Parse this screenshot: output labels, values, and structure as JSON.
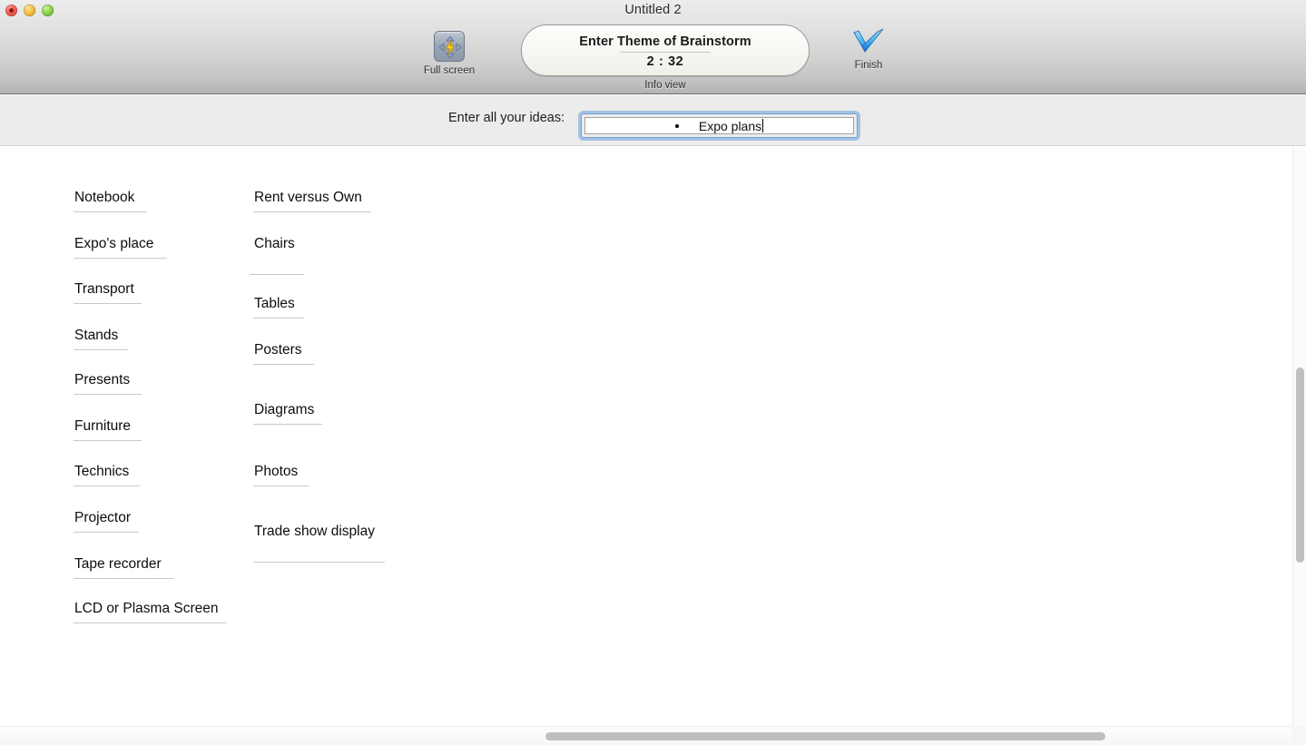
{
  "window": {
    "title": "Untitled 2",
    "traffic_lights": [
      "close",
      "minimize",
      "maximize"
    ]
  },
  "toolbar": {
    "fullscreen": {
      "label": "Full screen",
      "icon": "fullscreen-bolt-icon"
    },
    "infoview": {
      "label": "Info view",
      "theme_prompt": "Enter Theme of Brainstorm",
      "timer": "2 : 32"
    },
    "finish": {
      "label": "Finish",
      "icon": "checkmark-icon"
    }
  },
  "prompt": {
    "label": "Enter all your ideas:",
    "input_value": "Expo plans",
    "input_placeholder": "",
    "bullet": "•"
  },
  "ideas": {
    "column_1": [
      "Notebook",
      "Expo's place",
      "Transport",
      "Stands",
      "Presents",
      "Furniture",
      "Technics",
      "Projector",
      "Tape recorder",
      "LCD or Plasma Screen"
    ],
    "column_2": [
      "Rent versus Own",
      "Chairs",
      "Tables",
      "Posters",
      "Diagrams",
      "Photos",
      "Trade show display"
    ]
  },
  "scrollbars": {
    "vertical_present": true,
    "horizontal_present": true
  },
  "colors": {
    "accent_focus_ring": "#6fa0cf",
    "toolbar_top": "#ededed",
    "toolbar_bottom": "#b3b3b3",
    "prompt_bar": "#ececec",
    "rule": "#c9c9c9",
    "scroll_thumb": "#bfbfbf",
    "finish_check": "#2ea8ea"
  }
}
